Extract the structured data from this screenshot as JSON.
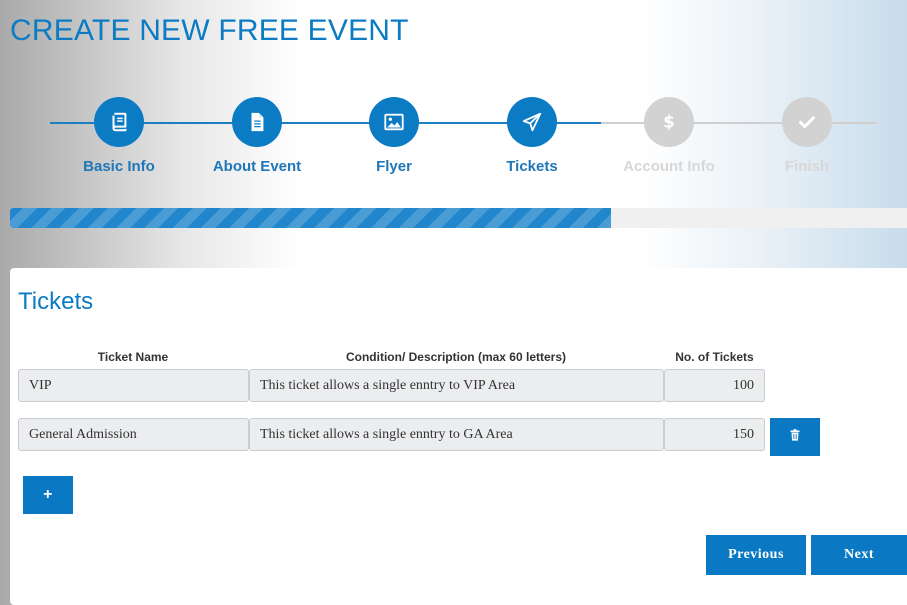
{
  "page": {
    "title": "CREATE NEW FREE EVENT"
  },
  "wizard": {
    "steps": [
      {
        "label": "Basic Info",
        "icon": "book-icon",
        "state": "complete"
      },
      {
        "label": "About Event",
        "icon": "document-icon",
        "state": "complete"
      },
      {
        "label": "Flyer",
        "icon": "image-icon",
        "state": "complete"
      },
      {
        "label": "Tickets",
        "icon": "paper-plane-icon",
        "state": "current"
      },
      {
        "label": "Account Info",
        "icon": "dollar-icon",
        "state": "pending"
      },
      {
        "label": "Finish",
        "icon": "check-icon",
        "state": "pending"
      }
    ],
    "progress_fraction": 0.67
  },
  "tickets": {
    "title": "Tickets",
    "headers": {
      "name": "Ticket Name",
      "description": "Condition/ Description (max 60 letters)",
      "count": "No. of Tickets"
    },
    "rows": [
      {
        "name": "VIP",
        "description": "This ticket allows a single enntry to VIP Area",
        "count": "100"
      },
      {
        "name": "General Admission",
        "description": "This ticket allows a single enntry to GA Area",
        "count": "150"
      }
    ],
    "add_label": "+"
  },
  "nav": {
    "previous_label": "Previous",
    "next_label": "Next"
  },
  "colors": {
    "accent": "#0b7bc4",
    "inactive": "#d2d2d2",
    "field_bg": "#ebedef"
  }
}
